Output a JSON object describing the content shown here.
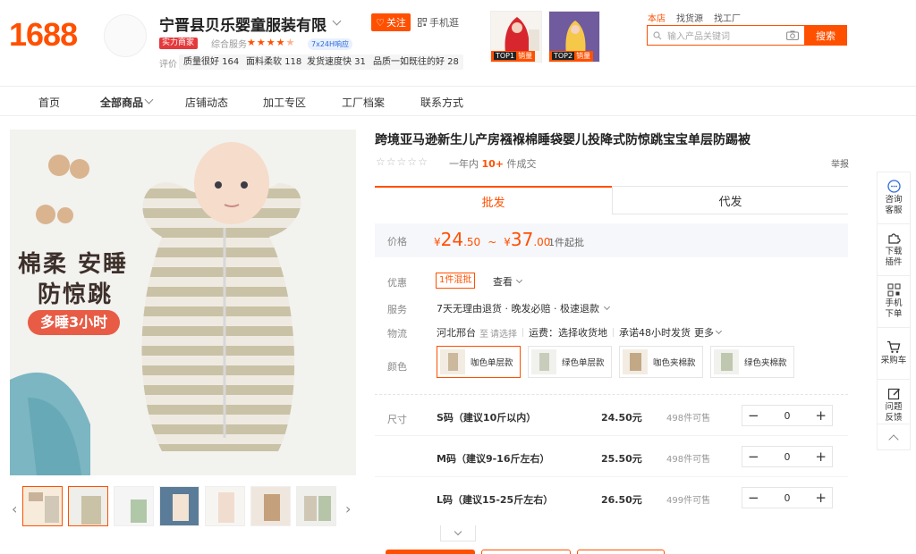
{
  "brand": {
    "logo": "1688"
  },
  "shop": {
    "name": "宁晋县贝乐婴童服装有限",
    "follow_label": "关注",
    "mobile_label": "手机逛",
    "strength_badge": "实力商家",
    "overall_label": "综合服务",
    "service_badge": "7x24H响应",
    "eval_label": "评价",
    "eval_tags": [
      "质量很好 164",
      "面料柔软 118",
      "发货速度快 31",
      "品质一如既往的好 28"
    ],
    "top_products": [
      {
        "badge_prefix": "TOP1",
        "badge_text": "销量"
      },
      {
        "badge_prefix": "TOP2",
        "badge_text": "销量"
      }
    ]
  },
  "search": {
    "tabs": [
      "本店",
      "找货源",
      "找工厂"
    ],
    "placeholder": "输入产品关键词",
    "button": "搜索"
  },
  "nav": {
    "items": [
      "首页",
      "全部商品",
      "店铺动态",
      "加工专区",
      "工厂档案",
      "联系方式"
    ]
  },
  "gallery": {
    "overlay_line1": "棉柔 安睡",
    "overlay_line2": "防惊跳",
    "overlay_pill": "多睡3小时",
    "thumbnail_count": 7
  },
  "product": {
    "title": "跨境亚马逊新生儿产房襁褓棉睡袋婴儿投降式防惊跳宝宝单层防踢被",
    "sold_prefix": "一年内",
    "sold_count": "10+",
    "sold_suffix": "件成交",
    "report": "举报",
    "tab_wholesale": "批发",
    "tab_dropship": "代发",
    "price_label": "价格",
    "price_currency": "¥",
    "price_min_int": "24",
    "price_min_dec": ".50",
    "price_sep": "~",
    "price_max_int": "37",
    "price_max_dec": ".00",
    "min_order": "1件起批",
    "promo_label": "优惠",
    "promo_tag": "1件混批",
    "promo_view": "查看",
    "service_label": "服务",
    "service_text": "7天无理由退货 · 晚发必赔 · 极速退款",
    "shipping_label": "物流",
    "ship_from": "河北邢台",
    "ship_to_label": "至",
    "ship_to_select": "请选择",
    "freight": "运费：选择收货地",
    "promise": "承诺48小时发货",
    "more": "更多",
    "color_label": "颜色",
    "colors": [
      "咖色单层款",
      "绿色单层款",
      "咖色夹棉款",
      "绿色夹棉款"
    ],
    "size_label": "尺寸",
    "sizes": [
      {
        "name": "S码（建议10斤以内）",
        "price": "24.50元",
        "stock": "498件可售",
        "qty": "0"
      },
      {
        "name": "M码（建议9-16斤左右）",
        "price": "25.50元",
        "stock": "498件可售",
        "qty": "0"
      },
      {
        "name": "L码（建议15-25斤左右）",
        "price": "26.50元",
        "stock": "499件可售",
        "qty": "0"
      }
    ]
  },
  "float_bar": {
    "items": [
      "咨询客服",
      "下载插件",
      "手机下单",
      "采购车",
      "问题反馈"
    ]
  },
  "colors": {
    "accent": "#ff5000",
    "price_bg": "#f6f7fb"
  }
}
